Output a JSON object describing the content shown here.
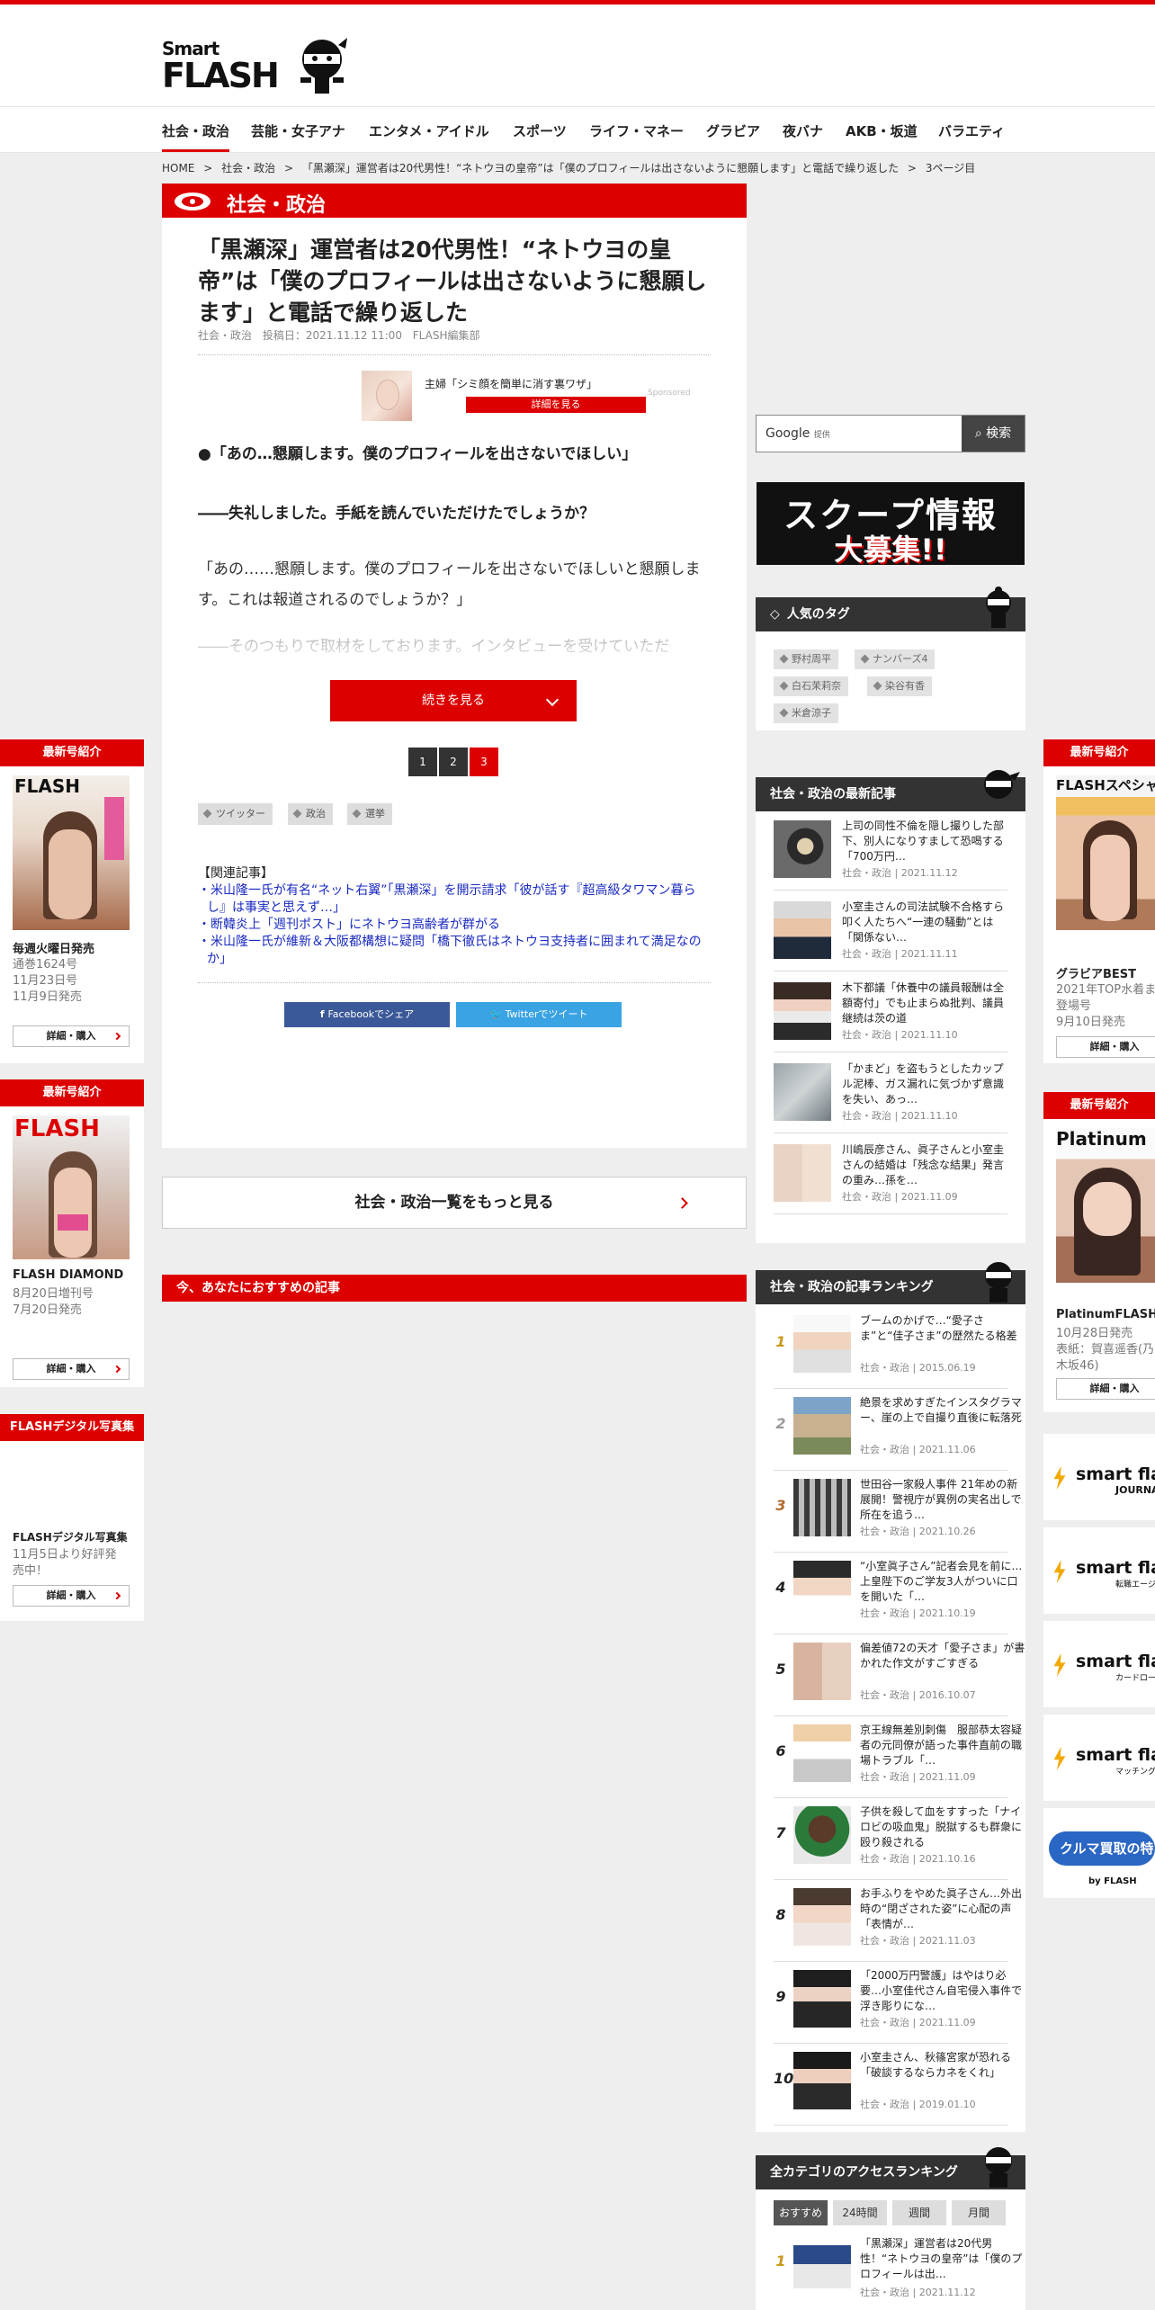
{
  "brand": {
    "smart": "Smart",
    "flash": "FLASH"
  },
  "nav": [
    "社会・政治",
    "芸能・女子アナ",
    "エンタメ・アイドル",
    "スポーツ",
    "ライフ・マネー",
    "グラビア",
    "夜バナ",
    "AKB・坂道",
    "バラエティ"
  ],
  "breadcrumb": [
    "HOME",
    ">",
    "社会・政治",
    ">",
    "「黒瀬深」運営者は20代男性！“ネトウヨの皇帝”は「僕のプロフィールは出さないように懇願します」と電話で繰り返した",
    ">",
    "3ページ目"
  ],
  "article": {
    "category": "社会・政治",
    "title": "「黒瀬深」運営者は20代男性！“ネトウヨの皇帝”は「僕のプロフィールは出さないように懇願します」と電話で繰り返した",
    "meta": [
      "社会・政治",
      "投稿日：2021.11.12 11:00",
      "FLASH編集部"
    ],
    "sponsor": {
      "text": "主婦「シミ顔を簡単に消す裏ワザ」",
      "button": "詳細を見る",
      "tag": "Sponsored"
    },
    "p1": "●「あの…懇願します。僕のプロフィールを出さないでほしい」",
    "p2": "――失礼しました。手紙を読んでいただけたでしょうか？",
    "p3": "「あの……懇願します。僕のプロフィールを出さないでほしいと懇願します。これは報道されるのでしょうか？」",
    "p4": "――そのつもりで取材をしております。インタビューを受けていただ",
    "more_button": "続きを見る",
    "pages": [
      "1",
      "2",
      "3"
    ],
    "tags": [
      "ツイッター",
      "政治",
      "選挙"
    ],
    "related_head": "【関連記事】",
    "related": [
      "・米山隆一氏が有名“ネット右翼”「黒瀬深」を開示請求「彼が話す『超高級タワマン暮らし』は事実と思えず…」",
      "・断韓炎上「週刊ポスト」にネトウヨ高齢者が群がる",
      "・米山隆一氏が維新＆大阪都構想に疑問「橋下徹氏はネトウヨ支持者に囲まれて満足なのか」"
    ],
    "share_fb": "Facebookでシェア",
    "share_tw": "Twitterでツイート"
  },
  "more_list": "社会・政治一覧をもっと見る",
  "recommend_head": "今、あなたにおすすめの記事",
  "left": {
    "w1": {
      "head": "最新号紹介",
      "name": "毎週火曜日発売",
      "info": [
        "通巻1624号",
        "11月23日号",
        "11月9日発売"
      ],
      "button": "詳細・購入",
      "cover_logo": "FLASH"
    },
    "w2": {
      "head": "最新号紹介",
      "name": "FLASH DIAMOND",
      "info": [
        "8月20日増刊号",
        "7月20日発売"
      ],
      "button": "詳細・購入",
      "cover_logo": "FLASH"
    },
    "w3": {
      "head": "FLASHデジタル写真集",
      "name": "FLASHデジタル写真集",
      "info": [
        "11月5日より好評発",
        "売中！"
      ],
      "button": "詳細・購入"
    }
  },
  "search": {
    "google": "Google",
    "small": "提供",
    "button": "検索"
  },
  "scoop": {
    "l1": "スクープ情報",
    "l2": "大募集!!"
  },
  "popular_tags": {
    "head": "人気のタグ",
    "items": [
      "野村周平",
      "ナンバーズ4",
      "白石茉莉奈",
      "染谷有香",
      "米倉涼子"
    ]
  },
  "latest": {
    "head": "社会・政治の最新記事",
    "items": [
      {
        "title": "上司の同性不倫を隠し撮りした部下、別人になりすまして恐喝する「700万円…",
        "meta": "社会・政治 | 2021.11.12"
      },
      {
        "title": "小室圭さんの司法試験不合格すら叩く人たちへ“一連の騒動”とは「関係ない…",
        "meta": "社会・政治 | 2021.11.11"
      },
      {
        "title": "木下都議「休養中の議員報酬は全額寄付」でも止まらぬ批判、議員継続は茨の道",
        "meta": "社会・政治 | 2021.11.10"
      },
      {
        "title": "「かまど」を盗もうとしたカップル泥棒、ガス漏れに気づかず意識を失い、あっ…",
        "meta": "社会・政治 | 2021.11.10"
      },
      {
        "title": "川嶋辰彦さん、眞子さんと小室圭さんの結婚は「残念な結果」発言の重み…孫を…",
        "meta": "社会・政治 | 2021.11.09"
      }
    ]
  },
  "ranking": {
    "head": "社会・政治の記事ランキング",
    "items": [
      {
        "n": "1",
        "title": "ブームのかげで…“愛子さま”と“佳子さま”の歴然たる格差",
        "meta": "社会・政治 | 2015.06.19"
      },
      {
        "n": "2",
        "title": "絶景を求めすぎたインスタグラマー、崖の上で自撮り直後に転落死",
        "meta": "社会・政治 | 2021.11.06"
      },
      {
        "n": "3",
        "title": "世田谷一家殺人事件 21年めの新展開！警視庁が異例の実名出しで所在を追う…",
        "meta": "社会・政治 | 2021.10.26"
      },
      {
        "n": "4",
        "title": "“小室眞子さん”記者会見を前に…上皇陛下のご学友3人がついに口を開いた「…",
        "meta": "社会・政治 | 2021.10.19"
      },
      {
        "n": "5",
        "title": "偏差値72の天才「愛子さま」が書かれた作文がすごすぎる",
        "meta": "社会・政治 | 2016.10.07"
      },
      {
        "n": "6",
        "title": "京王線無差別刺傷　服部恭太容疑者の元同僚が語った事件直前の職場トラブル「…",
        "meta": "社会・政治 | 2021.11.09"
      },
      {
        "n": "7",
        "title": "子供を殺して血をすすった「ナイロビの吸血鬼」脱獄するも群衆に殴り殺される",
        "meta": "社会・政治 | 2021.10.16"
      },
      {
        "n": "8",
        "title": "お手ふりをやめた眞子さん…外出時の“閉ざされた姿”に心配の声「表情が…",
        "meta": "社会・政治 | 2021.11.03"
      },
      {
        "n": "9",
        "title": "「2000万円警護」はやはり必要…小室佳代さん自宅侵入事件で浮き彫りにな…",
        "meta": "社会・政治 | 2021.11.09"
      },
      {
        "n": "10",
        "title": "小室圭さん、秋篠宮家が恐れる「破談するならカネをくれ」",
        "meta": "社会・政治 | 2019.01.10"
      }
    ]
  },
  "access": {
    "head": "全カテゴリのアクセスランキング",
    "tabs": [
      "おすすめ",
      "24時間",
      "週間",
      "月間"
    ],
    "item": {
      "n": "1",
      "title": "「黒瀬深」運営者は20代男性！“ネトウヨの皇帝”は「僕のプロフィールは出…",
      "meta": "社会・政治 | 2021.11.12"
    }
  },
  "far_right": {
    "w1": {
      "head": "最新号紹介",
      "cover": "FLASHスペシャ",
      "name": "グラビアBEST",
      "info": [
        "2021年TOP水着ま",
        "登場号",
        "9月10日発売"
      ],
      "button": "詳細・購入"
    },
    "w2": {
      "head": "最新号紹介",
      "cover": "Platinum",
      "name": "PlatinumFLASH",
      "info": [
        "10月28日発売",
        "表紙：賀喜遥香(乃",
        "木坂46)"
      ],
      "button": "詳細・購入"
    },
    "banners": [
      {
        "title": "smart flash",
        "sub": "JOURNAL"
      },
      {
        "title": "smart fla",
        "sub": "転職エージェント"
      },
      {
        "title": "smart fla",
        "sub": "カードローン"
      },
      {
        "title": "smart fla",
        "sub": "マッチングアプリ"
      }
    ],
    "car": {
      "title": "クルマ買取の特",
      "by": "by FLASH"
    }
  },
  "colors": {
    "accent": "#dd0000",
    "dark": "#333333",
    "link": "#1a2ac0"
  }
}
